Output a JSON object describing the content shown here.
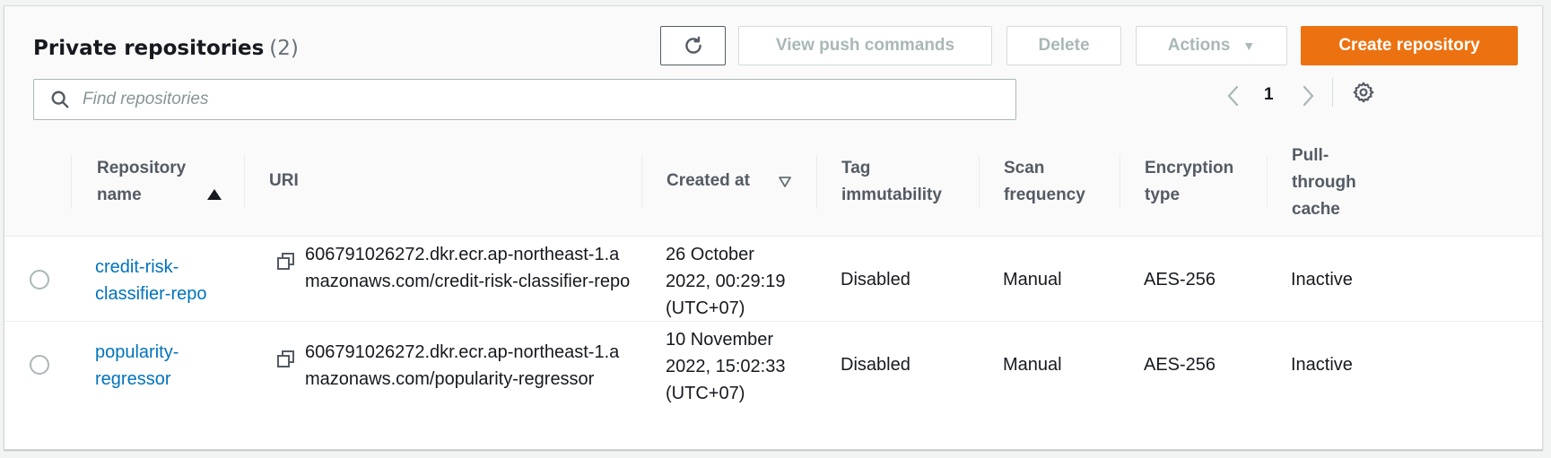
{
  "header": {
    "title": "Private repositories",
    "count": "(2)",
    "buttons": {
      "refresh_icon": "refresh-icon",
      "view_push_commands": "View push commands",
      "delete": "Delete",
      "actions": "Actions",
      "create_repository": "Create repository"
    },
    "colors": {
      "primary": "#ec7211",
      "link": "#0073bb"
    }
  },
  "search": {
    "placeholder": "Find repositories",
    "value": ""
  },
  "pagination": {
    "current_page": "1"
  },
  "table": {
    "columns": [
      "Repository name",
      "URI",
      "Created at",
      "Tag immutability",
      "Scan frequency",
      "Encryption type",
      "Pull-through cache"
    ],
    "rows": [
      {
        "name": "credit-risk-classifier-repo",
        "uri": "606791026272.dkr.ecr.ap-northeast-1.amazonaws.com/credit-risk-classifier-repo",
        "created_at": "26 October 2022, 00:29:19 (UTC+07)",
        "tag_immutability": "Disabled",
        "scan_frequency": "Manual",
        "encryption_type": "AES-256",
        "pull_through_cache": "Inactive"
      },
      {
        "name": "popularity-regressor",
        "uri": "606791026272.dkr.ecr.ap-northeast-1.amazonaws.com/popularity-regressor",
        "created_at": "10 November 2022, 15:02:33 (UTC+07)",
        "tag_immutability": "Disabled",
        "scan_frequency": "Manual",
        "encryption_type": "AES-256",
        "pull_through_cache": "Inactive"
      }
    ]
  }
}
